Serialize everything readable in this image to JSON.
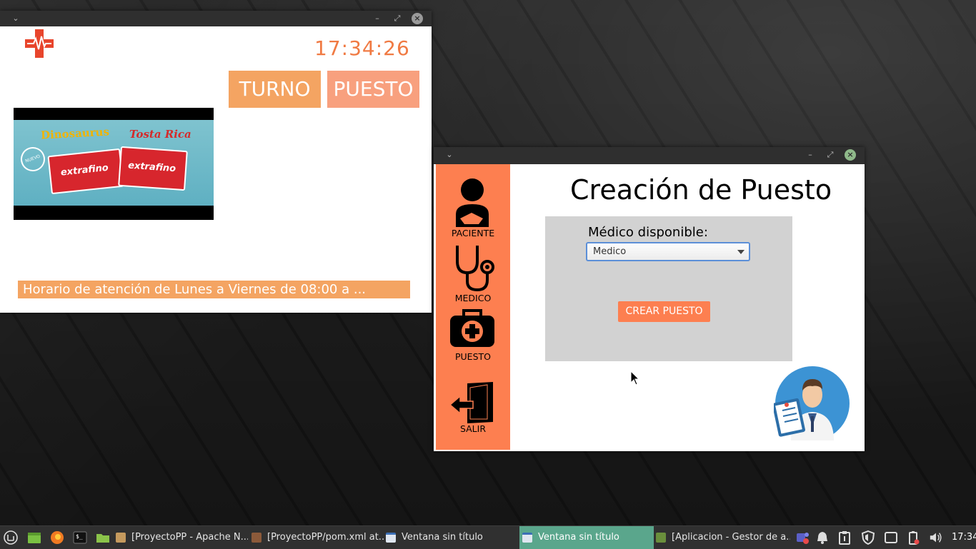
{
  "window_display": {
    "clock": "17:34:26",
    "turno_label": "TURNO",
    "puesto_label": "PUESTO",
    "ad": {
      "brand1": "Dinosaurus",
      "brand2": "Tosta Rica",
      "product": "extrafino",
      "badge": "NUEVO"
    },
    "marquee": "Horario de atención de Lunes a Viernes de 08:00 a ..."
  },
  "window_form": {
    "sidebar": [
      {
        "label": "PACIENTE",
        "icon": "patient-icon"
      },
      {
        "label": "MEDICO",
        "icon": "stethoscope-icon"
      },
      {
        "label": "PUESTO",
        "icon": "medical-kit-icon"
      },
      {
        "label": "SALIR",
        "icon": "exit-door-icon"
      }
    ],
    "title": "Creación de Puesto",
    "medico_label": "Médico disponible:",
    "medico_select_value": "Medico",
    "crear_button": "CREAR PUESTO"
  },
  "taskbar": {
    "tasks": [
      {
        "label": "[ProyectoPP - Apache N...",
        "active": false
      },
      {
        "label": "[ProyectoPP/pom.xml at...",
        "active": false
      },
      {
        "label": "Ventana sin título",
        "active": false
      },
      {
        "label": "Ventana sin título",
        "active": true
      },
      {
        "label": "[Aplicacion - Gestor de a...",
        "active": false
      }
    ],
    "time": "17:34"
  },
  "colors": {
    "accent_orange": "#fd7f50",
    "button_orange": "#f4a462",
    "active_task": "#5aa68c"
  }
}
